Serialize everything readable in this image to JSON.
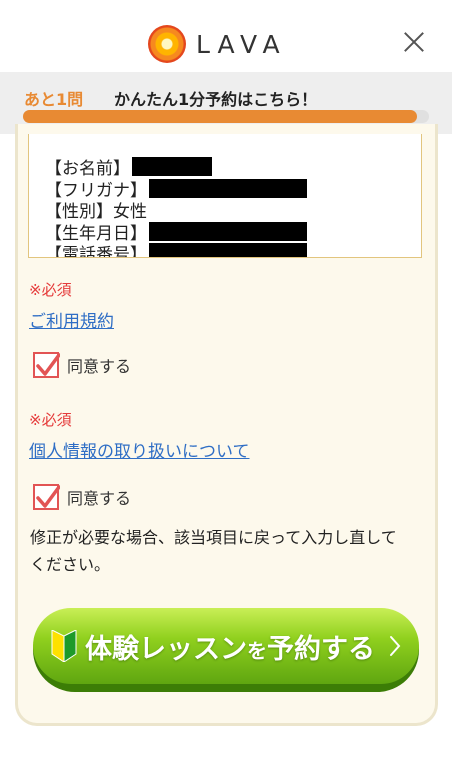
{
  "header": {
    "logo_text": "LAVA"
  },
  "banner": {
    "remaining": "あと1問",
    "cta": "かんたん1分予約はこちら！",
    "progress_percent": 97
  },
  "summary": {
    "lines": [
      {
        "label": "【お名前】",
        "redact_width": 80
      },
      {
        "label": "【フリガナ】",
        "redact_width": 158
      },
      {
        "label": "【性別】女性",
        "redact_width": 0
      },
      {
        "label": "【生年月日】",
        "redact_width": 158
      },
      {
        "label": "【電話番号】",
        "redact_width": 158
      }
    ]
  },
  "terms": {
    "required": "※必須",
    "link": "ご利用規約",
    "agree": "同意する",
    "checked": true
  },
  "privacy": {
    "required": "※必須",
    "link": "個人情報の取り扱いについて",
    "agree": "同意する",
    "checked": true
  },
  "note": "修正が必要な場合、該当項目に戻って入力し直してください。",
  "submit": {
    "part1": "体験レッスン",
    "particle": "を",
    "part2": "予約する"
  },
  "colors": {
    "accent": "#e88a33",
    "required": "#e53b3b",
    "link": "#2f6ec5",
    "button_green": "#90d01e"
  }
}
